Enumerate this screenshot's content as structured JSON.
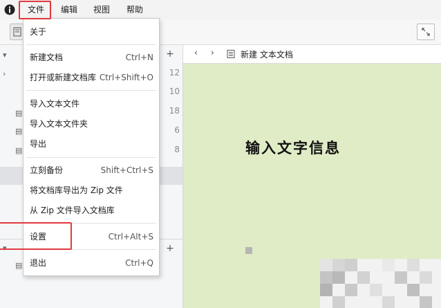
{
  "menubar": {
    "app_icon": "info-icon",
    "items": [
      "文件",
      "编辑",
      "视图",
      "帮助"
    ]
  },
  "file_menu": {
    "items": [
      {
        "label": "关于",
        "shortcut": ""
      },
      {
        "label": "新建文档",
        "shortcut": "Ctrl+N"
      },
      {
        "label": "打开或新建文档库",
        "shortcut": "Ctrl+Shift+O"
      },
      {
        "label": "导入文本文件",
        "shortcut": ""
      },
      {
        "label": "导入文本文件夹",
        "shortcut": ""
      },
      {
        "label": "导出",
        "shortcut": ""
      },
      {
        "label": "立刻备份",
        "shortcut": "Shift+Ctrl+S"
      },
      {
        "label": "将文档库导出为 Zip 文件",
        "shortcut": ""
      },
      {
        "label": "从 Zip 文件导入文档库",
        "shortcut": ""
      },
      {
        "label": "设置",
        "shortcut": "Ctrl+Alt+S"
      },
      {
        "label": "退出",
        "shortcut": "Ctrl+Q"
      }
    ]
  },
  "sidebar": {
    "add_label": "+",
    "counts": [
      "12",
      "10",
      "18",
      "6",
      "8"
    ]
  },
  "editor": {
    "back": "‹",
    "forward": "›",
    "doc_title": "新建 文本文档",
    "content": "输入文字信息"
  },
  "colors": {
    "highlight": "#e0393e",
    "editor_background": "#e0ecc6",
    "sidebar_background": "#f5f6f8"
  }
}
